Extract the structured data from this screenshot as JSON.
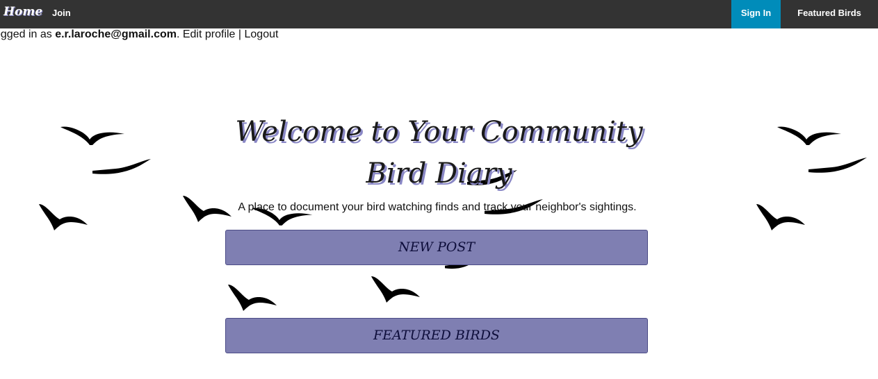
{
  "nav": {
    "home_label": "Home",
    "join_label": "Join",
    "sign_in_label": "Sign In",
    "featured_label": "Featured Birds"
  },
  "status": {
    "prefix": "ogged in as ",
    "email": "e.r.laroche@gmail.com",
    "period": ". ",
    "edit_profile": "Edit profile",
    "separator": " | ",
    "logout": "Logout"
  },
  "hero": {
    "title_line1": "Welcome to Your Community",
    "title_line2": "Bird Diary",
    "subtitle": "A place to document your bird watching finds and track your neighbor's sightings.",
    "new_post_label": "NEW POST",
    "featured_birds_label": "FEATURED BIRDS"
  },
  "colors": {
    "navbar": "#333333",
    "sign_in_bg": "#008cba",
    "button_bg": "#7f7fb2",
    "title_shadow": "#8a88c6"
  },
  "decorations": {
    "bird_icon": "flying-bird-silhouette-icon"
  }
}
